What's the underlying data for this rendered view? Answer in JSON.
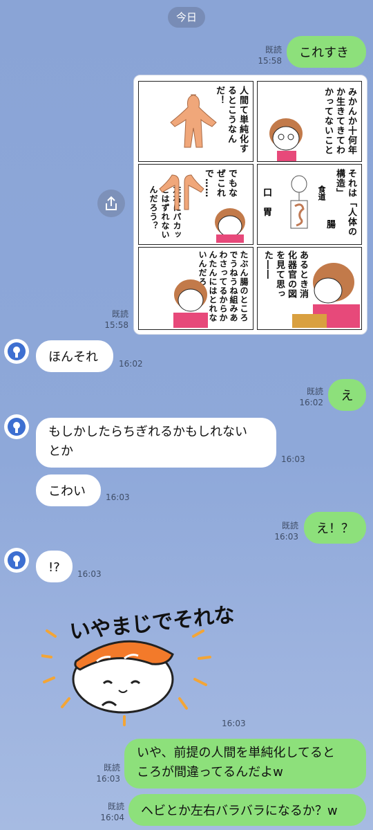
{
  "date_divider": "今日",
  "messages": [
    {
      "text": "これすき",
      "read": "既読",
      "time": "15:58"
    },
    {
      "read": "既読",
      "time": "15:58"
    },
    {
      "text": "ほんそれ",
      "time": "16:02"
    },
    {
      "text": "え",
      "read": "既読",
      "time": "16:02"
    },
    {
      "line1": "もしかしたらちぎれるかもしれない",
      "line2": "とか",
      "time": "16:03"
    },
    {
      "text": "こわい",
      "time": "16:03"
    },
    {
      "text": "え！？",
      "read": "既読",
      "time": "16:03"
    },
    {
      "text": "!?",
      "time": "16:03"
    },
    {
      "sticker_text": "いやまじでそれな",
      "time": "16:03"
    },
    {
      "line1": "いや、前提の人間を単純化してると",
      "line2": "ころが間違ってるんだよw",
      "read": "既読",
      "time": "16:03"
    },
    {
      "text": "ヘビとか左右バラバラになるか？w",
      "read": "既読",
      "time": "16:04"
    }
  ],
  "manga": {
    "p1": "みかんか十何年か生きてきてわかってないこと",
    "p2": "人間て単純化するとこうなんだ！",
    "p3a": "それは「人体の構造」",
    "p3_mouth": "口",
    "p3_esophagus": "食道",
    "p3_stomach": "胃",
    "p3_intestine": "腸",
    "p4a": "でもなぜこれで……",
    "p4b": "左右にパカッとはずれないんだろう？",
    "p5": "あるとき消化器官の図を見て思った――",
    "p6": "たぶん腸のところでうねうね組みあわさってるからかんたんにはとれないんだろう…"
  },
  "colors": {
    "background": "#8ea8d9",
    "outgoing_bubble": "#8de07b",
    "incoming_bubble": "#ffffff",
    "avatar_bulb": "#3d6fd1"
  },
  "icons": [
    "share-icon",
    "lightbulb-icon"
  ]
}
